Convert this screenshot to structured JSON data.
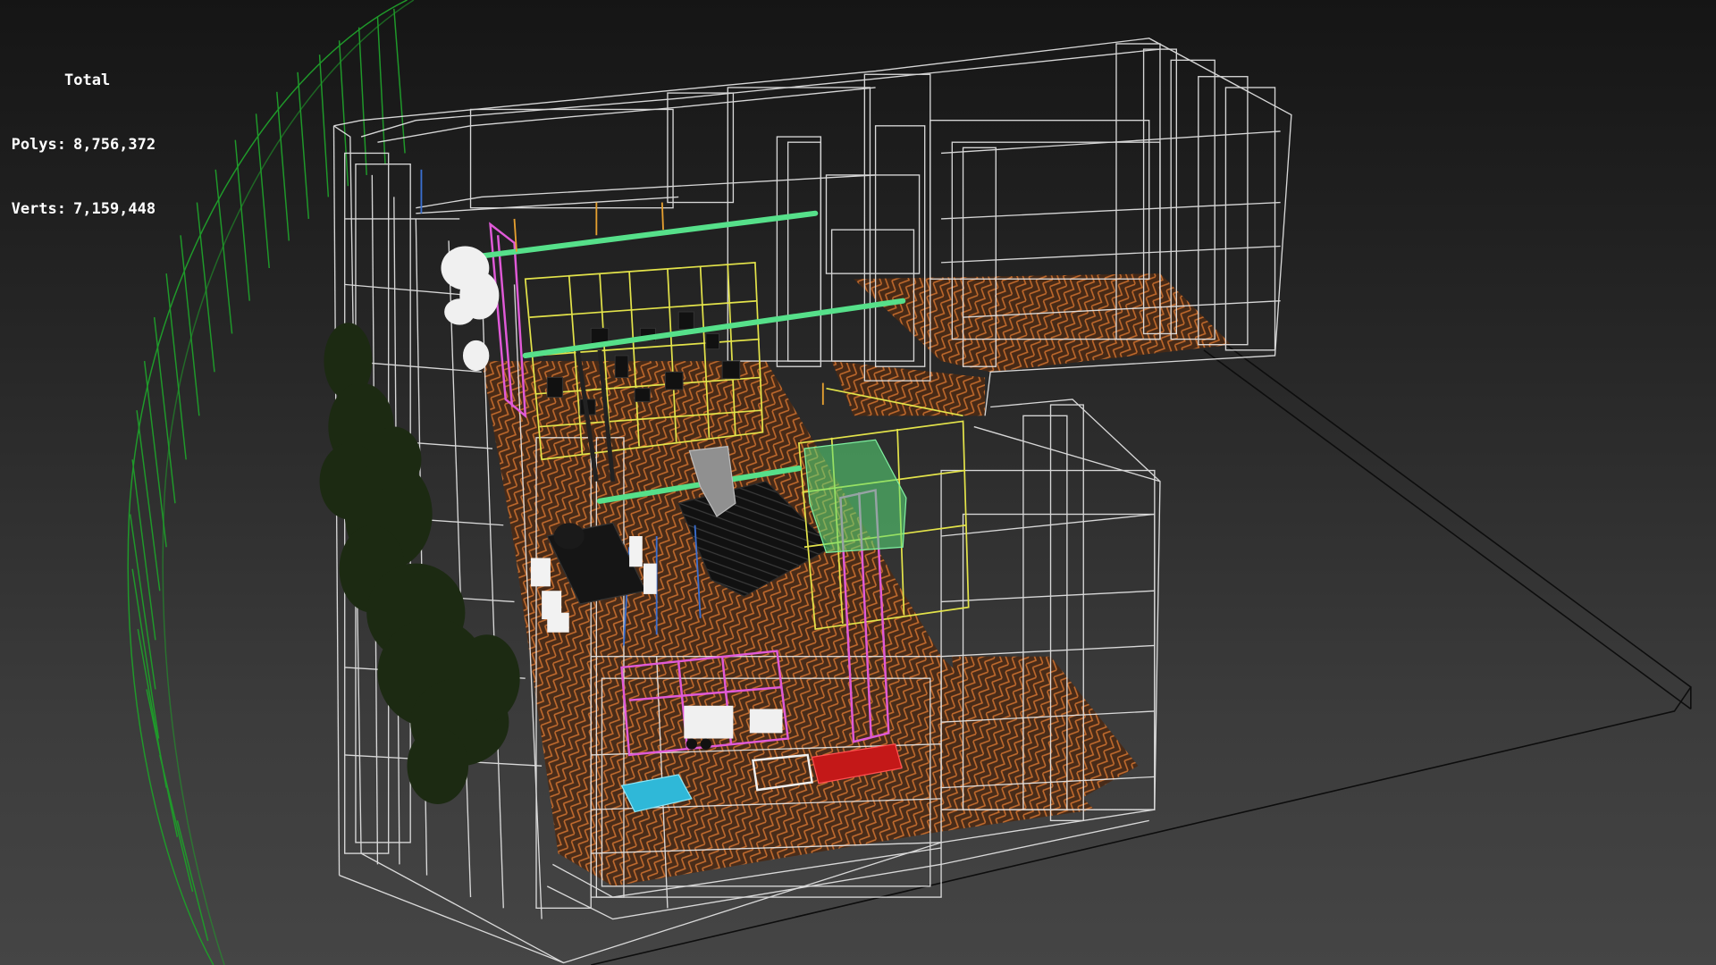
{
  "viewport": {
    "stats": {
      "title": "Total",
      "polys_label": "Polys:",
      "polys_value": "8,756,372",
      "verts_label": "Verts:",
      "verts_value": "7,159,448"
    },
    "render_mode": "wireframe",
    "colors": {
      "background_top": "#151515",
      "background_bottom": "#454545",
      "wire_white": "#e6e6e6",
      "floor_orange": "#c8682a",
      "skydome_green": "#1f9a2a",
      "trees": "#1c2a12",
      "shelf_yellow": "#e3e34a",
      "frame_magenta": "#e05ad8",
      "track_light_green": "#56e08a",
      "rug": "#1a1a1a",
      "sofa_red": "#c41818",
      "table_cyan": "#2fb8d8",
      "object_white": "#f2f2f2"
    }
  }
}
